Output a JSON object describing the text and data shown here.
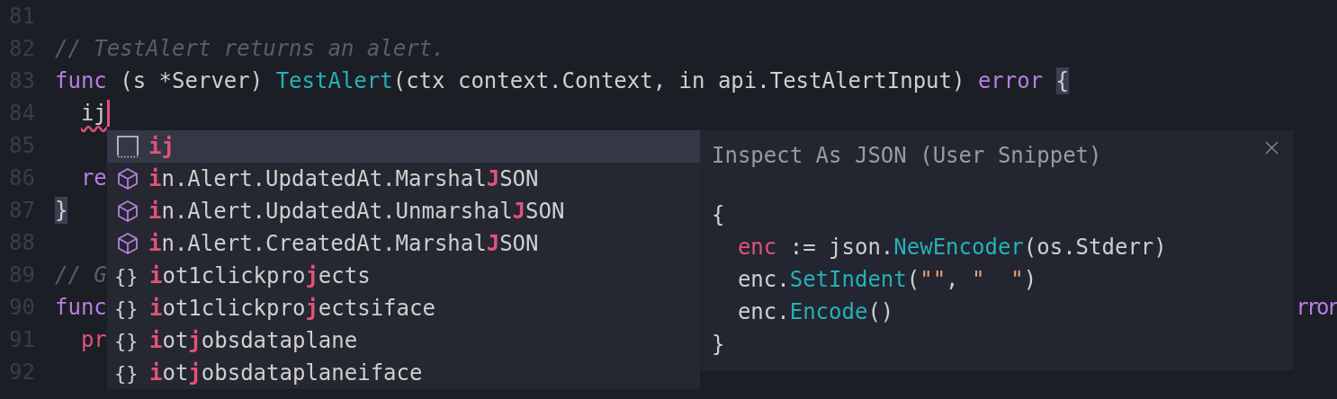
{
  "editor": {
    "lines": [
      {
        "number": "81"
      },
      {
        "number": "82",
        "tokens": [
          {
            "text": "// TestAlert returns an alert.",
            "kind": "comment"
          }
        ]
      },
      {
        "number": "83",
        "tokens": [
          {
            "text": "func",
            "kind": "keyword"
          },
          {
            "text": " (s *Server) ",
            "kind": "plain"
          },
          {
            "text": "TestAlert",
            "kind": "function"
          },
          {
            "text": "(ctx context.Context, in api.TestAlertInput) ",
            "kind": "plain"
          },
          {
            "text": "error",
            "kind": "keyword"
          },
          {
            "text": "{",
            "kind": "bracket-match",
            "spaced": true
          }
        ]
      },
      {
        "number": "84",
        "indented": true,
        "cursor": true,
        "tokens": [
          {
            "text": "ij",
            "kind": "error"
          }
        ]
      },
      {
        "number": "85"
      },
      {
        "number": "86",
        "indented": true,
        "tokens": [
          {
            "text": "re",
            "kind": "keyword"
          }
        ]
      },
      {
        "number": "87",
        "tokens": [
          {
            "text": "}",
            "kind": "bracket-match"
          }
        ]
      },
      {
        "number": "88"
      },
      {
        "number": "89",
        "tokens": [
          {
            "text": "// G",
            "kind": "comment"
          }
        ]
      },
      {
        "number": "90",
        "tokens": [
          {
            "text": "func",
            "kind": "keyword"
          }
        ],
        "right_tokens": [
          {
            "text": "rror",
            "kind": "keyword"
          }
        ]
      },
      {
        "number": "91",
        "indented": true,
        "tokens": [
          {
            "text": "pr",
            "kind": "variable"
          }
        ]
      },
      {
        "number": "92"
      }
    ]
  },
  "suggestions": [
    {
      "kind": "snippet",
      "selected": true,
      "parts": [
        {
          "text": "ij",
          "match": true
        }
      ]
    },
    {
      "kind": "method",
      "selected": false,
      "parts": [
        {
          "text": "i",
          "match": true
        },
        {
          "text": "n.Alert.UpdatedAt.Marshal",
          "match": false
        },
        {
          "text": "J",
          "match": true
        },
        {
          "text": "SON",
          "match": false
        }
      ]
    },
    {
      "kind": "method",
      "selected": false,
      "parts": [
        {
          "text": "i",
          "match": true
        },
        {
          "text": "n.Alert.UpdatedAt.Unmarshal",
          "match": false
        },
        {
          "text": "J",
          "match": true
        },
        {
          "text": "SON",
          "match": false
        }
      ]
    },
    {
      "kind": "method",
      "selected": false,
      "parts": [
        {
          "text": "i",
          "match": true
        },
        {
          "text": "n.Alert.CreatedAt.Marshal",
          "match": false
        },
        {
          "text": "J",
          "match": true
        },
        {
          "text": "SON",
          "match": false
        }
      ]
    },
    {
      "kind": "module",
      "icon": "{}",
      "selected": false,
      "parts": [
        {
          "text": "i",
          "match": true
        },
        {
          "text": "ot1clickpro",
          "match": false
        },
        {
          "text": "j",
          "match": true
        },
        {
          "text": "ects",
          "match": false
        }
      ]
    },
    {
      "kind": "module",
      "icon": "{}",
      "selected": false,
      "parts": [
        {
          "text": "i",
          "match": true
        },
        {
          "text": "ot1clickpro",
          "match": false
        },
        {
          "text": "j",
          "match": true
        },
        {
          "text": "ectsiface",
          "match": false
        }
      ]
    },
    {
      "kind": "module",
      "icon": "{}",
      "selected": false,
      "parts": [
        {
          "text": "i",
          "match": true
        },
        {
          "text": "ot",
          "match": false
        },
        {
          "text": "j",
          "match": true
        },
        {
          "text": "obsdataplane",
          "match": false
        }
      ]
    },
    {
      "kind": "module",
      "icon": "{}",
      "selected": false,
      "parts": [
        {
          "text": "i",
          "match": true
        },
        {
          "text": "ot",
          "match": false
        },
        {
          "text": "j",
          "match": true
        },
        {
          "text": "obsdataplaneiface",
          "match": false
        }
      ]
    }
  ],
  "details": {
    "title": "Inspect As JSON (User Snippet)",
    "code": [
      {
        "tokens": [
          {
            "text": "{",
            "kind": "plain"
          }
        ]
      },
      {
        "indented": true,
        "tokens": [
          {
            "text": "enc",
            "kind": "variable"
          },
          {
            "text": " := json.",
            "kind": "plain"
          },
          {
            "text": "NewEncoder",
            "kind": "function"
          },
          {
            "text": "(os.Stderr)",
            "kind": "plain"
          }
        ]
      },
      {
        "indented": true,
        "tokens": [
          {
            "text": "enc.",
            "kind": "plain"
          },
          {
            "text": "SetIndent",
            "kind": "function"
          },
          {
            "text": "(",
            "kind": "plain"
          },
          {
            "text": "\"\"",
            "kind": "string"
          },
          {
            "text": ", ",
            "kind": "plain"
          },
          {
            "text": "\"  \"",
            "kind": "string"
          },
          {
            "text": ")",
            "kind": "plain"
          }
        ]
      },
      {
        "indented": true,
        "tokens": [
          {
            "text": "enc.",
            "kind": "plain"
          },
          {
            "text": "Encode",
            "kind": "function"
          },
          {
            "text": "()",
            "kind": "plain"
          }
        ]
      },
      {
        "tokens": [
          {
            "text": "}",
            "kind": "plain"
          }
        ]
      }
    ]
  }
}
